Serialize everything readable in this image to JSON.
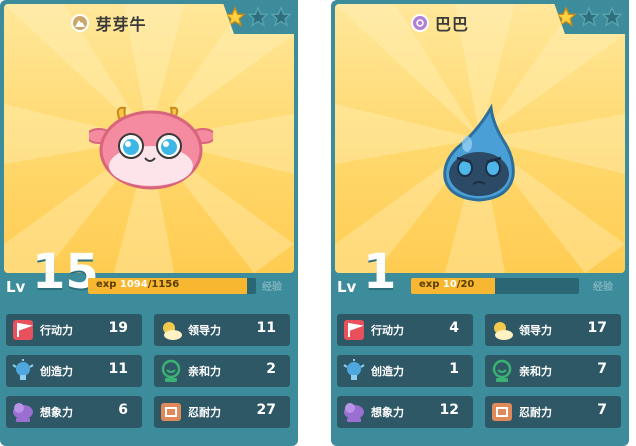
{
  "cards": [
    {
      "name": "芽芽牛",
      "element_icon": "mountain-icon",
      "element_color": "#c9a66b",
      "stars_filled": 1,
      "stars_total": 3,
      "level_label": "Lv",
      "level": "15",
      "exp_label": "exp",
      "exp_current": "1094",
      "exp_max": "/1156",
      "exp_fraction": 0.946,
      "exp_button": "经验",
      "creature": "pink-cow-creature",
      "stats": [
        {
          "label": "行动力",
          "value": "19",
          "icon": "flag-icon",
          "color": "#e8505b"
        },
        {
          "label": "领导力",
          "value": "11",
          "icon": "sun-cloud-icon",
          "color": "#f2c94c"
        },
        {
          "label": "创造力",
          "value": "11",
          "icon": "bulb-icon",
          "color": "#4ea8de"
        },
        {
          "label": "亲和力",
          "value": "2",
          "icon": "smile-icon",
          "color": "#3bb273"
        },
        {
          "label": "想象力",
          "value": "6",
          "icon": "cloud-icon",
          "color": "#9b6fd1"
        },
        {
          "label": "忍耐力",
          "value": "27",
          "icon": "shield-icon",
          "color": "#e08a5b"
        }
      ]
    },
    {
      "name": "巴巴",
      "element_icon": "swirl-icon",
      "element_color": "#b07fd6",
      "stars_filled": 1,
      "stars_total": 3,
      "level_label": "Lv",
      "level": "1",
      "exp_label": "exp",
      "exp_current": "10",
      "exp_max": "/20",
      "exp_fraction": 0.5,
      "exp_button": "经验",
      "creature": "blue-drop-creature",
      "stats": [
        {
          "label": "行动力",
          "value": "4",
          "icon": "flag-icon",
          "color": "#e8505b"
        },
        {
          "label": "领导力",
          "value": "17",
          "icon": "sun-cloud-icon",
          "color": "#f2c94c"
        },
        {
          "label": "创造力",
          "value": "1",
          "icon": "bulb-icon",
          "color": "#4ea8de"
        },
        {
          "label": "亲和力",
          "value": "7",
          "icon": "smile-icon",
          "color": "#3bb273"
        },
        {
          "label": "想象力",
          "value": "12",
          "icon": "cloud-icon",
          "color": "#9b6fd1"
        },
        {
          "label": "忍耐力",
          "value": "7",
          "icon": "shield-icon",
          "color": "#e08a5b"
        }
      ]
    }
  ]
}
